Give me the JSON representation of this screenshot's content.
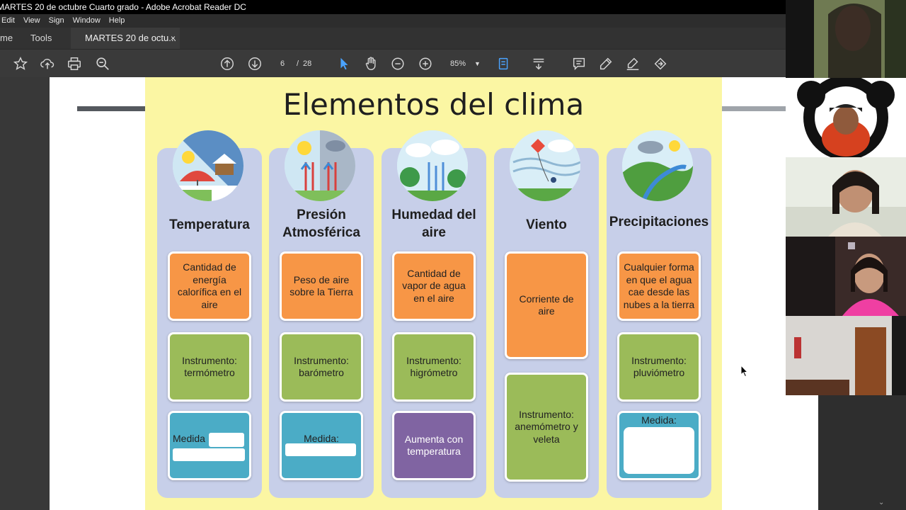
{
  "window": {
    "title": "MARTES 20 de octubre  Cuarto grado - Adobe Acrobat Reader DC"
  },
  "menu": [
    "Edit",
    "View",
    "Sign",
    "Window",
    "Help"
  ],
  "tabs": {
    "home": "me",
    "tools": "Tools",
    "document": "MARTES 20 de octu...",
    "close": "×"
  },
  "toolbar": {
    "page_current": "6",
    "page_separator": "/",
    "page_total": "28",
    "zoom": "85%"
  },
  "slide": {
    "title": "Elementos del clima",
    "columns": [
      {
        "heading": "Temperatura",
        "definition": "Cantidad de energía calorífica en el aire",
        "instrument": "Instrumento: termómetro",
        "measure": "Medida"
      },
      {
        "heading": "Presión Atmosférica",
        "definition": "Peso de aire sobre la Tierra",
        "instrument": "Instrumento: barómetro",
        "measure": "Medida:"
      },
      {
        "heading": "Humedad del aire",
        "definition": "Cantidad de vapor de agua en el aire",
        "instrument": "Instrumento: higrómetro",
        "measure": "Aumenta con temperatura"
      },
      {
        "heading": "Viento",
        "definition": "Corriente de aire",
        "instrument": "Instrumento: anemómetro y veleta"
      },
      {
        "heading": "Precipitaciones",
        "definition": "Cualquier forma en que el agua cae desde las nubes a la tierra",
        "instrument": "Instrumento: pluviómetro",
        "measure": "Medida:"
      }
    ]
  },
  "colors": {
    "slide_bg": "#fbf6a3",
    "column_bg": "#c7cfe9",
    "orange": "#f79646",
    "green": "#9bbb59",
    "blue": "#4bacc6",
    "purple": "#8064a2"
  }
}
